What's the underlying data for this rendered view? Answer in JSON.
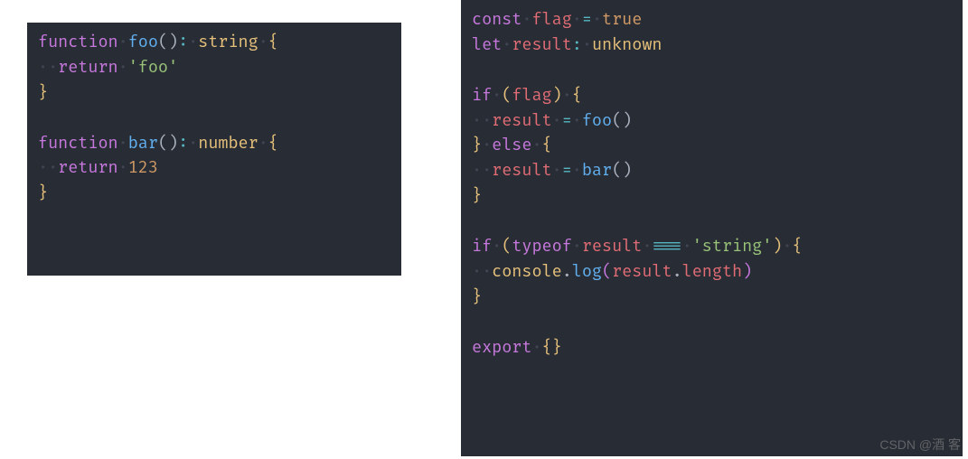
{
  "left_block": {
    "lines": [
      [
        {
          "cls": "kw",
          "text": "function"
        },
        {
          "cls": "dot",
          "text": "·"
        },
        {
          "cls": "fn",
          "text": "foo"
        },
        {
          "cls": "punc",
          "text": "()"
        },
        {
          "cls": "op",
          "text": ":"
        },
        {
          "cls": "dot",
          "text": "·"
        },
        {
          "cls": "type",
          "text": "string"
        },
        {
          "cls": "dot",
          "text": "·"
        },
        {
          "cls": "brace",
          "text": "{"
        }
      ],
      [
        {
          "cls": "dot",
          "text": "··"
        },
        {
          "cls": "kw",
          "text": "return"
        },
        {
          "cls": "dot",
          "text": "·"
        },
        {
          "cls": "str",
          "text": "'foo'"
        }
      ],
      [
        {
          "cls": "brace",
          "text": "}"
        }
      ],
      [],
      [
        {
          "cls": "kw",
          "text": "function"
        },
        {
          "cls": "dot",
          "text": "·"
        },
        {
          "cls": "fn",
          "text": "bar"
        },
        {
          "cls": "punc",
          "text": "()"
        },
        {
          "cls": "op",
          "text": ":"
        },
        {
          "cls": "dot",
          "text": "·"
        },
        {
          "cls": "type",
          "text": "number"
        },
        {
          "cls": "dot",
          "text": "·"
        },
        {
          "cls": "brace",
          "text": "{"
        }
      ],
      [
        {
          "cls": "dot",
          "text": "··"
        },
        {
          "cls": "kw",
          "text": "return"
        },
        {
          "cls": "dot",
          "text": "·"
        },
        {
          "cls": "num",
          "text": "123"
        }
      ],
      [
        {
          "cls": "brace",
          "text": "}"
        }
      ]
    ]
  },
  "right_block": {
    "lines": [
      [
        {
          "cls": "kw",
          "text": "const"
        },
        {
          "cls": "dot",
          "text": "·"
        },
        {
          "cls": "var",
          "text": "flag"
        },
        {
          "cls": "dot",
          "text": "·"
        },
        {
          "cls": "op",
          "text": "="
        },
        {
          "cls": "dot",
          "text": "·"
        },
        {
          "cls": "const",
          "text": "true"
        }
      ],
      [
        {
          "cls": "kw",
          "text": "let"
        },
        {
          "cls": "dot",
          "text": "·"
        },
        {
          "cls": "var",
          "text": "result"
        },
        {
          "cls": "op",
          "text": ":"
        },
        {
          "cls": "dot",
          "text": "·"
        },
        {
          "cls": "type",
          "text": "unknown"
        }
      ],
      [],
      [
        {
          "cls": "kw",
          "text": "if"
        },
        {
          "cls": "dot",
          "text": "·"
        },
        {
          "cls": "brace",
          "text": "("
        },
        {
          "cls": "var",
          "text": "flag"
        },
        {
          "cls": "brace",
          "text": ")"
        },
        {
          "cls": "dot",
          "text": "·"
        },
        {
          "cls": "brace",
          "text": "{"
        }
      ],
      [
        {
          "cls": "dot",
          "text": "··"
        },
        {
          "cls": "var",
          "text": "result"
        },
        {
          "cls": "dot",
          "text": "·"
        },
        {
          "cls": "op",
          "text": "="
        },
        {
          "cls": "dot",
          "text": "·"
        },
        {
          "cls": "fn",
          "text": "foo"
        },
        {
          "cls": "punc",
          "text": "()"
        }
      ],
      [
        {
          "cls": "brace",
          "text": "}"
        },
        {
          "cls": "dot",
          "text": "·"
        },
        {
          "cls": "kw",
          "text": "else"
        },
        {
          "cls": "dot",
          "text": "·"
        },
        {
          "cls": "brace",
          "text": "{"
        }
      ],
      [
        {
          "cls": "dot",
          "text": "··"
        },
        {
          "cls": "var",
          "text": "result"
        },
        {
          "cls": "dot",
          "text": "·"
        },
        {
          "cls": "op",
          "text": "="
        },
        {
          "cls": "dot",
          "text": "·"
        },
        {
          "cls": "fn",
          "text": "bar"
        },
        {
          "cls": "punc",
          "text": "()"
        }
      ],
      [
        {
          "cls": "brace",
          "text": "}"
        }
      ],
      [],
      [
        {
          "cls": "kw",
          "text": "if"
        },
        {
          "cls": "dot",
          "text": "·"
        },
        {
          "cls": "brace",
          "text": "("
        },
        {
          "cls": "kw",
          "text": "typeof"
        },
        {
          "cls": "dot",
          "text": "·"
        },
        {
          "cls": "var",
          "text": "result"
        },
        {
          "cls": "dot",
          "text": "·"
        },
        {
          "cls": "op",
          "text": "==="
        },
        {
          "cls": "dot",
          "text": "·"
        },
        {
          "cls": "str",
          "text": "'string'"
        },
        {
          "cls": "brace",
          "text": ")"
        },
        {
          "cls": "dot",
          "text": "·"
        },
        {
          "cls": "brace",
          "text": "{"
        }
      ],
      [
        {
          "cls": "dot",
          "text": "··"
        },
        {
          "cls": "obj",
          "text": "console"
        },
        {
          "cls": "punc",
          "text": "."
        },
        {
          "cls": "fn",
          "text": "log"
        },
        {
          "cls": "brace2",
          "text": "("
        },
        {
          "cls": "var",
          "text": "result"
        },
        {
          "cls": "punc",
          "text": "."
        },
        {
          "cls": "prop",
          "text": "length"
        },
        {
          "cls": "brace2",
          "text": ")"
        }
      ],
      [
        {
          "cls": "brace",
          "text": "}"
        }
      ],
      [],
      [
        {
          "cls": "kw",
          "text": "export"
        },
        {
          "cls": "dot",
          "text": "·"
        },
        {
          "cls": "brace",
          "text": "{}"
        }
      ]
    ]
  },
  "watermark": "CSDN @酒 客"
}
